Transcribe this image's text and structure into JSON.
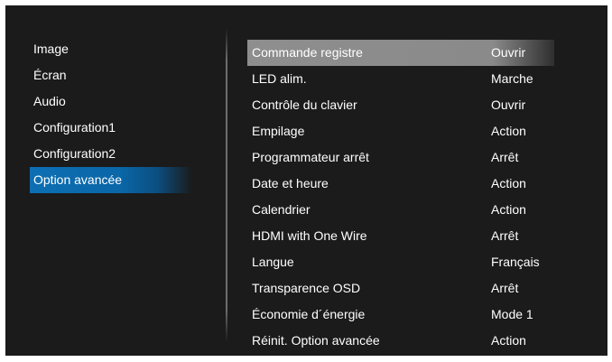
{
  "left_menu": {
    "items": [
      {
        "label": "Image"
      },
      {
        "label": "Écran"
      },
      {
        "label": "Audio"
      },
      {
        "label": "Configuration1"
      },
      {
        "label": "Configuration2"
      },
      {
        "label": "Option avancée",
        "active": true
      }
    ]
  },
  "settings": {
    "rows": [
      {
        "label": "Commande registre",
        "value": "Ouvrir",
        "selected": true
      },
      {
        "label": "LED alim.",
        "value": "Marche"
      },
      {
        "label": "Contrôle du clavier",
        "value": "Ouvrir"
      },
      {
        "label": "Empilage",
        "value": "Action"
      },
      {
        "label": "Programmateur arrêt",
        "value": "Arrêt"
      },
      {
        "label": "Date et heure",
        "value": "Action"
      },
      {
        "label": "Calendrier",
        "value": "Action"
      },
      {
        "label": "HDMI with One Wire",
        "value": "Arrêt"
      },
      {
        "label": "Langue",
        "value": "Français"
      },
      {
        "label": "Transparence OSD",
        "value": "Arrêt"
      },
      {
        "label": "Économie d´énergie",
        "value": "Mode 1"
      },
      {
        "label": "Réinit. Option avancée",
        "value": "Action"
      }
    ]
  },
  "colors": {
    "background": "#1b1b1b",
    "active_tab": "#0d6fb3",
    "selected_row": "#8e8e8e",
    "text": "#ffffff"
  }
}
